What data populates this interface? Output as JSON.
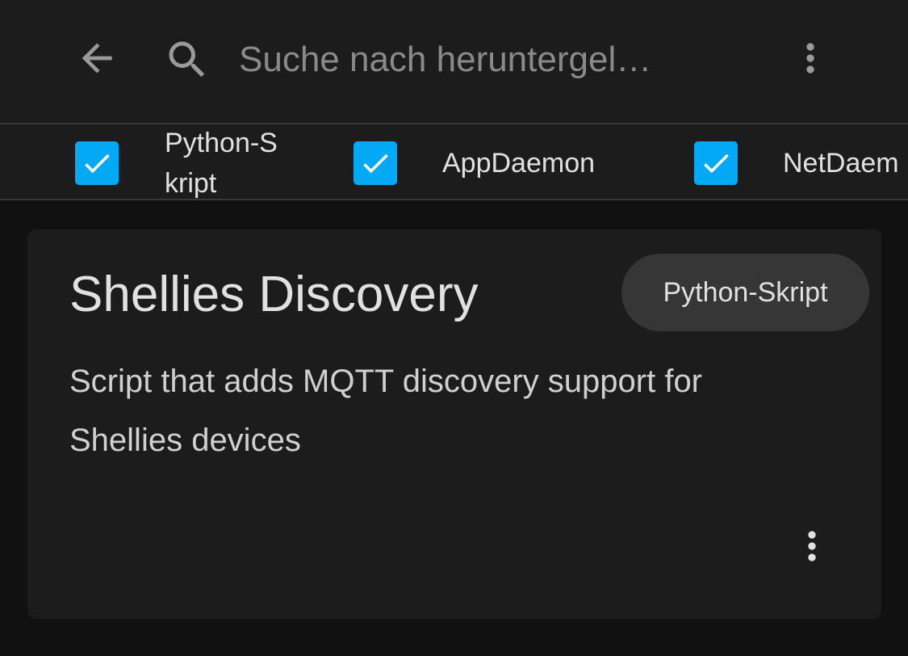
{
  "search": {
    "placeholder": "Suche nach heruntergel…",
    "value": ""
  },
  "icons": {
    "back": "arrow-left-icon",
    "search": "magnify-icon",
    "menu": "dots-vertical-icon",
    "check": "check-icon"
  },
  "colors": {
    "accent": "#03a9f4",
    "background": "#111111",
    "surface": "#1c1c1c",
    "chip": "#363636",
    "text": "#e1e1e1"
  },
  "filters": [
    {
      "label": "Python-Skript",
      "checked": true
    },
    {
      "label": "AppDaemon",
      "checked": true
    },
    {
      "label": "NetDaem",
      "checked": true
    }
  ],
  "card": {
    "title": "Shellies Discovery",
    "category": "Python-Skript",
    "description": "Script that adds MQTT discovery support for Shellies devices"
  }
}
